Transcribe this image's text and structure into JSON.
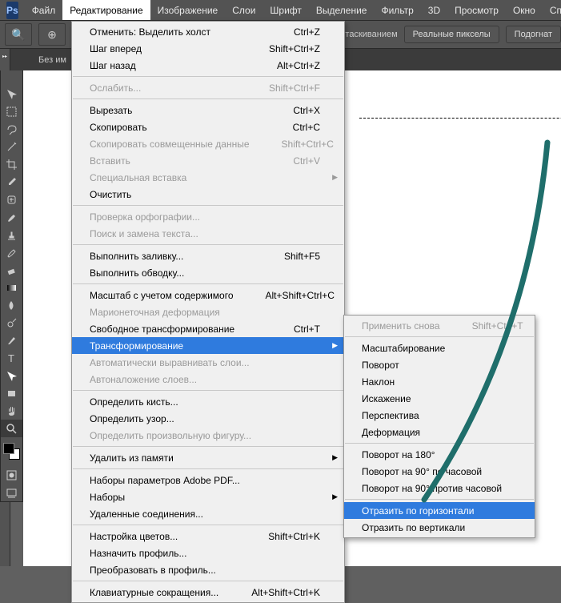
{
  "app": {
    "logo": "Ps"
  },
  "menubar": [
    "Файл",
    "Редактирование",
    "Изображение",
    "Слои",
    "Шрифт",
    "Выделение",
    "Фильтр",
    "3D",
    "Просмотр",
    "Окно",
    "Сп"
  ],
  "menubar_open_index": 1,
  "optbar": {
    "hint": "таскиванием",
    "btn1": "Реальные пикселы",
    "btn2": "Подогнат"
  },
  "doctab": "Без им",
  "menu_edit": [
    {
      "l": "Отменить: Выделить холст",
      "s": "Ctrl+Z"
    },
    {
      "l": "Шаг вперед",
      "s": "Shift+Ctrl+Z"
    },
    {
      "l": "Шаг назад",
      "s": "Alt+Ctrl+Z"
    },
    "-",
    {
      "l": "Ослабить...",
      "s": "Shift+Ctrl+F",
      "d": true
    },
    "-",
    {
      "l": "Вырезать",
      "s": "Ctrl+X"
    },
    {
      "l": "Скопировать",
      "s": "Ctrl+C"
    },
    {
      "l": "Скопировать совмещенные данные",
      "s": "Shift+Ctrl+C",
      "d": true
    },
    {
      "l": "Вставить",
      "s": "Ctrl+V",
      "d": true
    },
    {
      "l": "Специальная вставка",
      "sub": true,
      "d": true
    },
    {
      "l": "Очистить"
    },
    "-",
    {
      "l": "Проверка орфографии...",
      "d": true
    },
    {
      "l": "Поиск и замена текста...",
      "d": true
    },
    "-",
    {
      "l": "Выполнить заливку...",
      "s": "Shift+F5"
    },
    {
      "l": "Выполнить обводку..."
    },
    "-",
    {
      "l": "Масштаб с учетом содержимого",
      "s": "Alt+Shift+Ctrl+C"
    },
    {
      "l": "Марионеточная деформация",
      "d": true
    },
    {
      "l": "Свободное трансформирование",
      "s": "Ctrl+T"
    },
    {
      "l": "Трансформирование",
      "sub": true,
      "hi": true
    },
    {
      "l": "Автоматически выравнивать слои...",
      "d": true
    },
    {
      "l": "Автоналожение слоев...",
      "d": true
    },
    "-",
    {
      "l": "Определить кисть..."
    },
    {
      "l": "Определить узор..."
    },
    {
      "l": "Определить произвольную фигуру...",
      "d": true
    },
    "-",
    {
      "l": "Удалить из памяти",
      "sub": true
    },
    "-",
    {
      "l": "Наборы параметров Adobe PDF..."
    },
    {
      "l": "Наборы",
      "sub": true
    },
    {
      "l": "Удаленные соединения..."
    },
    "-",
    {
      "l": "Настройка цветов...",
      "s": "Shift+Ctrl+K"
    },
    {
      "l": "Назначить профиль..."
    },
    {
      "l": "Преобразовать в профиль..."
    },
    "-",
    {
      "l": "Клавиатурные сокращения...",
      "s": "Alt+Shift+Ctrl+K"
    }
  ],
  "menu_transform": [
    {
      "l": "Применить снова",
      "s": "Shift+Ctrl+T",
      "d": true
    },
    "-",
    {
      "l": "Масштабирование"
    },
    {
      "l": "Поворот"
    },
    {
      "l": "Наклон"
    },
    {
      "l": "Искажение"
    },
    {
      "l": "Перспектива"
    },
    {
      "l": "Деформация"
    },
    "-",
    {
      "l": "Поворот на 180°"
    },
    {
      "l": "Поворот на 90° по часовой"
    },
    {
      "l": "Поворот на 90° против часовой"
    },
    "-",
    {
      "l": "Отразить по горизонтали",
      "hi": true
    },
    {
      "l": "Отразить по вертикали"
    }
  ],
  "tools": [
    "move",
    "marquee",
    "lasso",
    "wand",
    "crop",
    "eyedrop",
    "heal",
    "brush",
    "stamp",
    "history",
    "eraser",
    "gradient",
    "blur",
    "dodge",
    "pen",
    "type",
    "path",
    "rect",
    "hand",
    "zoom"
  ]
}
